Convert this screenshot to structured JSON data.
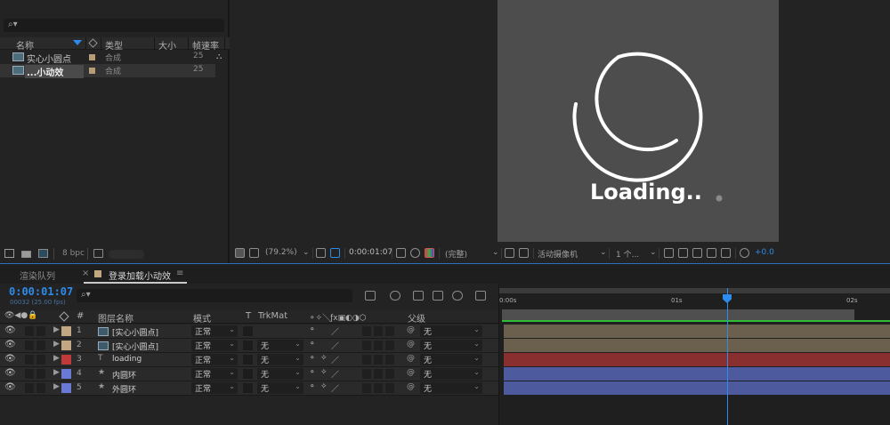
{
  "project": {
    "columns": {
      "name": "名称",
      "type": "类型",
      "size": "大小",
      "framerate": "帧速率"
    },
    "items": [
      {
        "name": "实心小圆点",
        "type": "合成",
        "framerate": "25"
      },
      {
        "name": "...小动效",
        "type": "合成",
        "framerate": "25"
      }
    ],
    "bpc": "8 bpc"
  },
  "viewer": {
    "zoom": "(79.2%)",
    "timecode": "0:00:01:07",
    "resolution": "(完整)",
    "camera": "活动摄像机",
    "views": "1 个...",
    "exposure": "+0.0",
    "preview": {
      "text": "Loading..",
      "dot_color": "#8a8a8a"
    }
  },
  "timeline": {
    "tab_render_queue": "渲染队列",
    "tab_close": "×",
    "tab_comp": "登录加载小动效",
    "tab_menu": "≡",
    "timecode": "0:00:01:07",
    "fps": "00032 (25.00 fps)",
    "columns": {
      "hash": "#",
      "layer_name": "图层名称",
      "mode": "模式",
      "t": "T",
      "trkmat": "TrkMat",
      "parent": "父级"
    },
    "ruler": {
      "start": "0:00s",
      "mark1": "01s",
      "mark2": "02s"
    },
    "layers": [
      {
        "num": "1",
        "name": "[实心小圆点]",
        "mode": "正常",
        "trkmat": "",
        "parent": "无",
        "label_color": "#c2a882",
        "src": "comp",
        "bar_color": "#6b5f4e"
      },
      {
        "num": "2",
        "name": "[实心小圆点]",
        "mode": "正常",
        "trkmat": "无",
        "parent": "无",
        "label_color": "#c2a882",
        "src": "comp",
        "bar_color": "#6b5f4e"
      },
      {
        "num": "3",
        "name": "loading",
        "mode": "正常",
        "trkmat": "无",
        "parent": "无",
        "label_color": "#c03a3a",
        "src": "T",
        "bar_color": "#8a2f2f"
      },
      {
        "num": "4",
        "name": "内圆环",
        "mode": "正常",
        "trkmat": "无",
        "parent": "无",
        "label_color": "#6a78d6",
        "src": "★",
        "bar_color": "#4e5a9e"
      },
      {
        "num": "5",
        "name": "外圆环",
        "mode": "正常",
        "trkmat": "无",
        "parent": "无",
        "label_color": "#6a78d6",
        "src": "★",
        "bar_color": "#4e5a9e"
      }
    ]
  }
}
